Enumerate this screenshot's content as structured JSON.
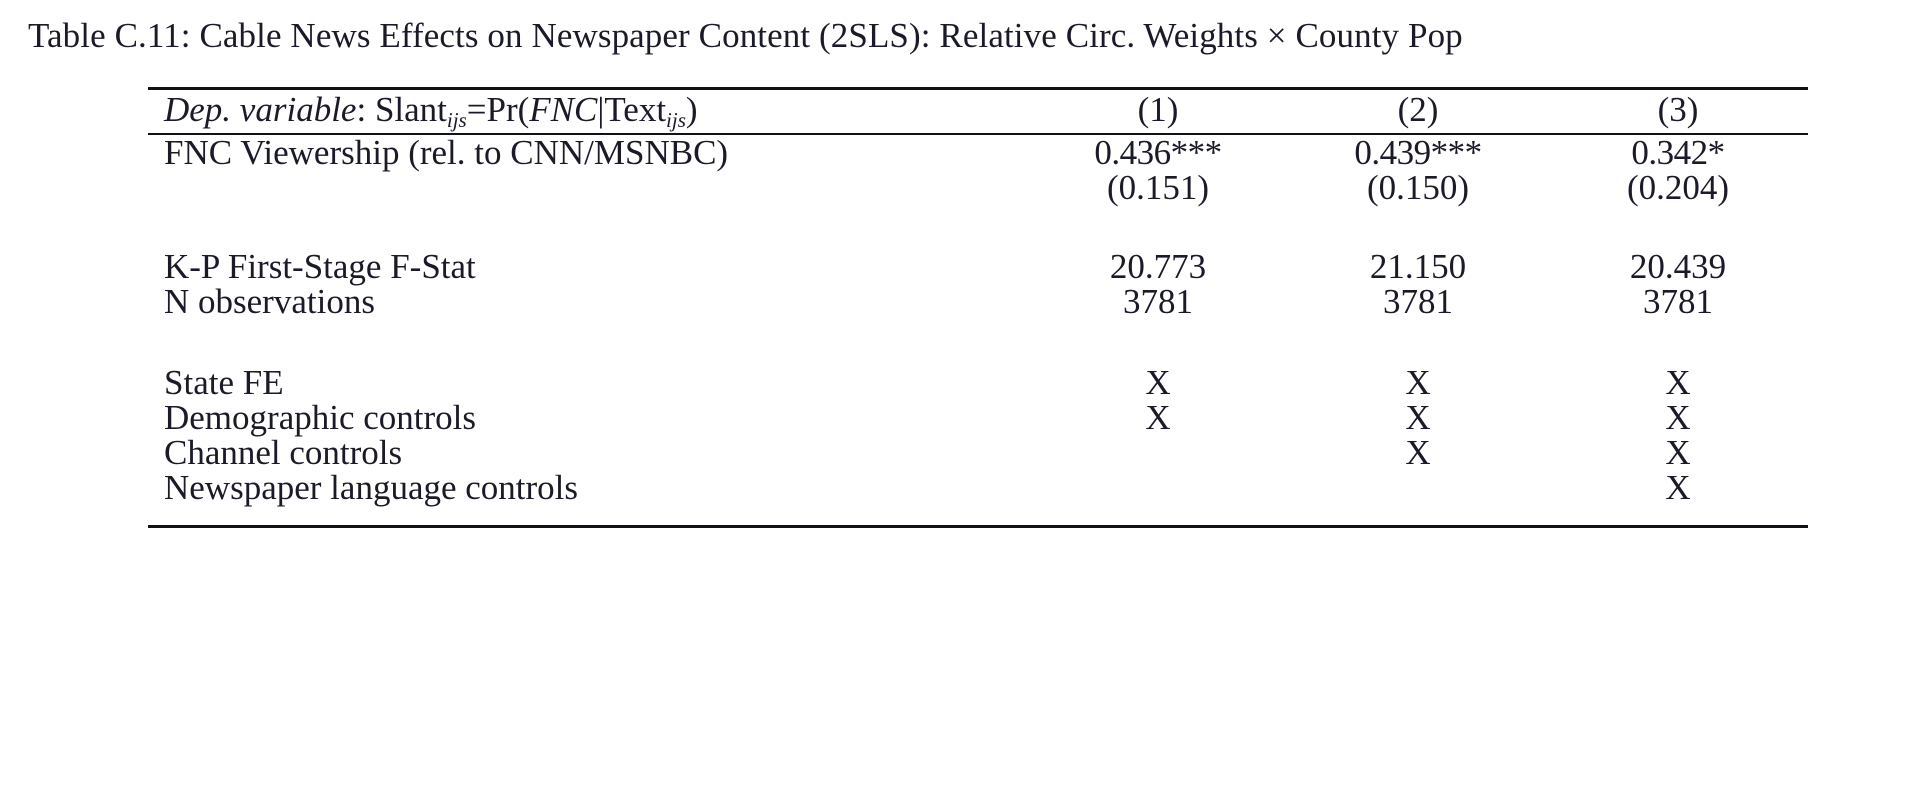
{
  "caption": {
    "text": "Table C.11: Cable News Effects on Newspaper Content (2SLS): Relative Circ. Weights × County Pop"
  },
  "table": {
    "dep_var_prefix": "Dep. variable",
    "dep_var_colon": ": ",
    "dep_var_slant": "Slant",
    "dep_var_slant_sub": "ijs",
    "dep_var_eq": "=Pr(",
    "dep_var_fnc": "FNC",
    "dep_var_bar": "|",
    "dep_var_text": "Text",
    "dep_var_text_sub": "ijs",
    "dep_var_close": ")",
    "columns": [
      "(1)",
      "(2)",
      "(3)"
    ],
    "rows": [
      {
        "label": "FNC Viewership (rel. to CNN/MSNBC)",
        "values": [
          "0.436***",
          "0.439***",
          "0.342*"
        ],
        "kind": "coefficient"
      },
      {
        "label": "",
        "values": [
          "(0.151)",
          "(0.150)",
          "(0.204)"
        ],
        "kind": "std-error"
      },
      {
        "label": "K-P First-Stage F-Stat",
        "values": [
          "20.773",
          "21.150",
          "20.439"
        ],
        "kind": "statistic"
      },
      {
        "label": "N observations",
        "values": [
          "3781",
          "3781",
          "3781"
        ],
        "kind": "statistic"
      },
      {
        "label": "State FE",
        "values": [
          "X",
          "X",
          "X"
        ],
        "kind": "indicator"
      },
      {
        "label": "Demographic controls",
        "values": [
          "X",
          "X",
          "X"
        ],
        "kind": "indicator"
      },
      {
        "label": "Channel controls",
        "values": [
          "",
          "X",
          "X"
        ],
        "kind": "indicator"
      },
      {
        "label": "Newspaper language controls",
        "values": [
          "",
          "",
          "X"
        ],
        "kind": "indicator"
      }
    ]
  },
  "chart_data": {
    "type": "table",
    "title": "Table C.11: Cable News Effects on Newspaper Content (2SLS): Relative Circ. Weights × County Pop",
    "columns": [
      "Dep. variable: Slant_ijs=Pr(FNC|Text_ijs)",
      "(1)",
      "(2)",
      "(3)"
    ],
    "rows": [
      [
        "FNC Viewership (rel. to CNN/MSNBC)",
        "0.436***",
        "0.439***",
        "0.342*"
      ],
      [
        "",
        "(0.151)",
        "(0.150)",
        "(0.204)"
      ],
      [
        "K-P First-Stage F-Stat",
        "20.773",
        "21.150",
        "20.439"
      ],
      [
        "N observations",
        "3781",
        "3781",
        "3781"
      ],
      [
        "State FE",
        "X",
        "X",
        "X"
      ],
      [
        "Demographic controls",
        "X",
        "X",
        "X"
      ],
      [
        "Channel controls",
        "",
        "X",
        "X"
      ],
      [
        "Newspaper language controls",
        "",
        "",
        "X"
      ]
    ]
  }
}
